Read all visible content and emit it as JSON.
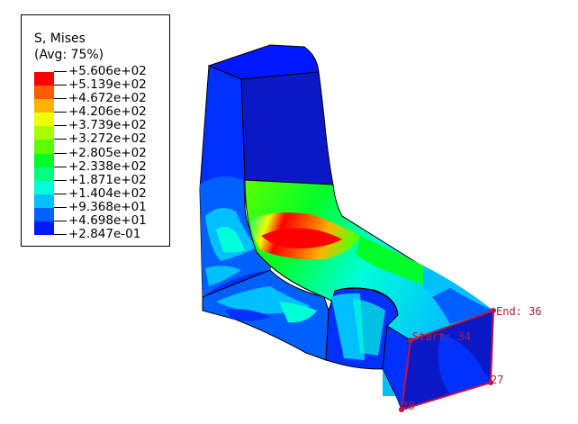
{
  "legend": {
    "title": "S, Mises",
    "subtitle": "(Avg: 75%)",
    "values": [
      "+5.606e+02",
      "+5.139e+02",
      "+4.672e+02",
      "+4.206e+02",
      "+3.739e+02",
      "+3.272e+02",
      "+2.805e+02",
      "+2.338e+02",
      "+1.871e+02",
      "+1.404e+02",
      "+9.368e+01",
      "+4.698e+01",
      "+2.847e-01"
    ],
    "colors": [
      "#ff0000",
      "#ff5a00",
      "#ffb200",
      "#f0ff00",
      "#a8ff00",
      "#5aff00",
      "#00ff2a",
      "#00ff82",
      "#00ffd8",
      "#00c0ff",
      "#0060ff",
      "#0018ff"
    ]
  },
  "path_labels": {
    "start": "Start: 34",
    "end": "End: 36",
    "node_27": "27",
    "node_28": "28"
  },
  "colors": {
    "path_line": "#c0143c",
    "dark_blue": "#0a18c8",
    "mid_blue": "#1a3cff",
    "edge": "#000000"
  }
}
